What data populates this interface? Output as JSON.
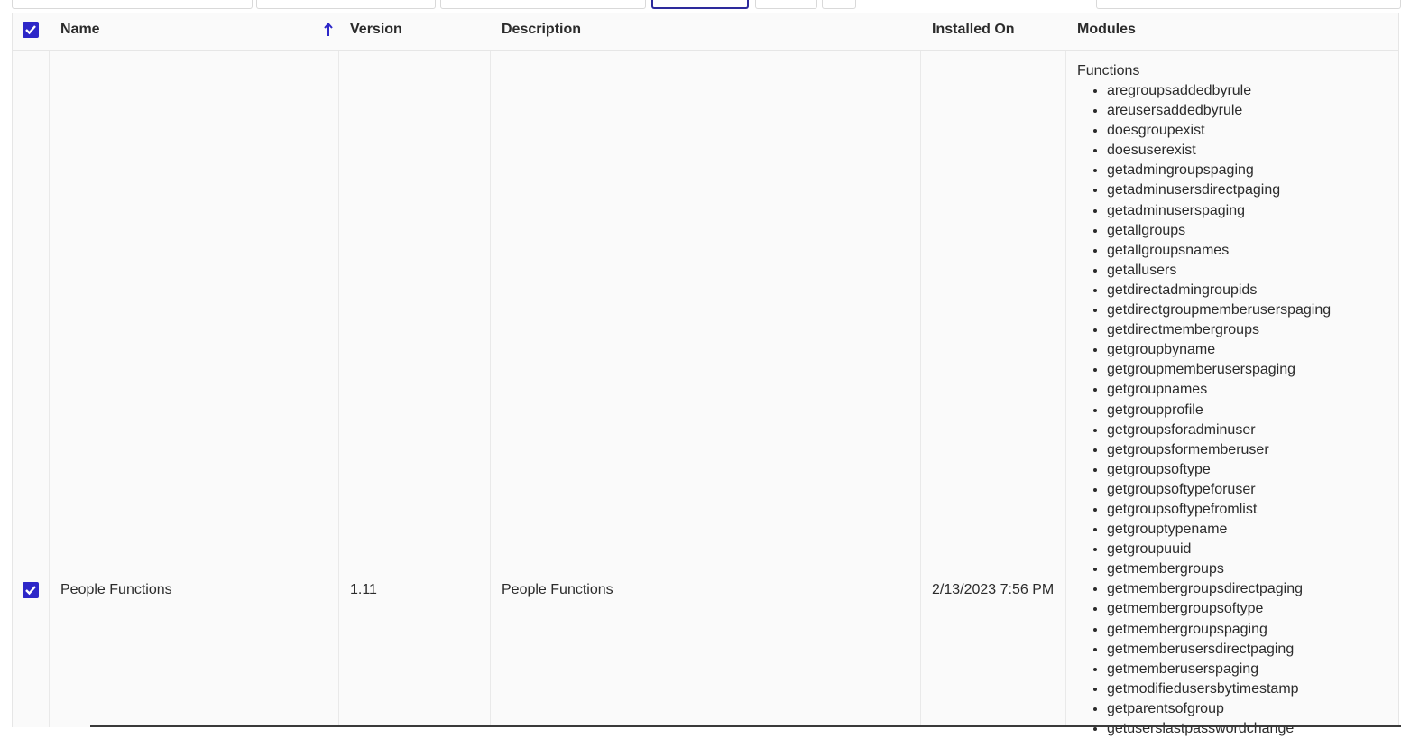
{
  "table": {
    "headers": {
      "name": "Name",
      "version": "Version",
      "description": "Description",
      "installed_on": "Installed On",
      "modules": "Modules"
    },
    "sort_icon": "arrow-up-icon",
    "select_all_checked": true
  },
  "rows": [
    {
      "checked": true,
      "name": "People Functions",
      "version": "1.11",
      "description": "People Functions",
      "installed_on": "2/13/2023 7:56 PM",
      "modules_title": "Functions",
      "modules": [
        "aregroupsaddedbyrule",
        "areusersaddedbyrule",
        "doesgroupexist",
        "doesuserexist",
        "getadmingroupspaging",
        "getadminusersdirectpaging",
        "getadminuserspaging",
        "getallgroups",
        "getallgroupsnames",
        "getallusers",
        "getdirectadmingroupids",
        "getdirectgroupmemberuserspaging",
        "getdirectmembergroups",
        "getgroupbyname",
        "getgroupmemberuserspaging",
        "getgroupnames",
        "getgroupprofile",
        "getgroupsforadminuser",
        "getgroupsformemberuser",
        "getgroupsoftype",
        "getgroupsoftypeforuser",
        "getgroupsoftypefromlist",
        "getgrouptypename",
        "getgroupuuid",
        "getmembergroups",
        "getmembergroupsdirectpaging",
        "getmembergroupsoftype",
        "getmembergroupspaging",
        "getmemberusersdirectpaging",
        "getmemberuserspaging",
        "getmodifiedusersbytimestamp",
        "getparentsofgroup",
        "getuserslastpasswordchange"
      ]
    }
  ],
  "colors": {
    "accent": "#2d27c8",
    "background": "#fafafa"
  }
}
